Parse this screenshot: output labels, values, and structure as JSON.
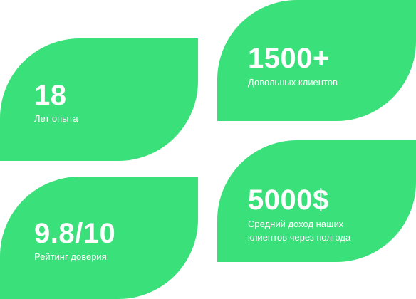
{
  "stats": {
    "experience": {
      "value": "18",
      "label": "Лет опыта"
    },
    "clients": {
      "value": "1500+",
      "label": "Довольных клиентов"
    },
    "rating": {
      "value": "9.8/10",
      "label": "Рейтинг доверия"
    },
    "income": {
      "value": "5000$",
      "label_line1": "Средний доход наших",
      "label_line2": "клиентов через полгода"
    }
  },
  "colors": {
    "card_background": "#3ae07a",
    "text": "#ffffff"
  }
}
